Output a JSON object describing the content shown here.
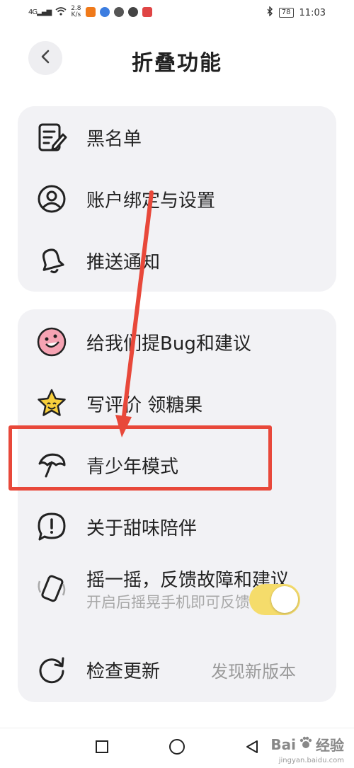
{
  "status_bar": {
    "network": "4G",
    "speed_value": "2.8",
    "speed_unit": "K/s",
    "battery": "78",
    "time": "11:03"
  },
  "header": {
    "back_icon": "chevron-left-icon",
    "title": "折叠功能"
  },
  "group1": [
    {
      "label": "黑名单",
      "icon": "document-edit-icon"
    },
    {
      "label": "账户绑定与设置",
      "icon": "user-circle-icon"
    },
    {
      "label": "推送通知",
      "icon": "bell-icon"
    }
  ],
  "group2": [
    {
      "label": "给我们提Bug和建议",
      "icon": "bug-face-icon"
    },
    {
      "label": "写评价 领糖果",
      "icon": "star-face-icon"
    },
    {
      "label": "青少年模式",
      "icon": "umbrella-icon"
    },
    {
      "label": "关于甜味陪伴",
      "icon": "info-bubble-icon"
    },
    {
      "label": "摇一摇，反馈故障和建议",
      "sublabel": "开启后摇晃手机即可反馈",
      "icon": "shake-phone-icon",
      "toggle_on": true
    },
    {
      "label": "检查更新",
      "value": "发现新版本",
      "icon": "refresh-icon"
    }
  ],
  "annotation": {
    "highlight_color": "#e8483a"
  },
  "watermark": {
    "brand": "Bai",
    "brand2": "经验",
    "url": "jingyan.baidu.com"
  }
}
